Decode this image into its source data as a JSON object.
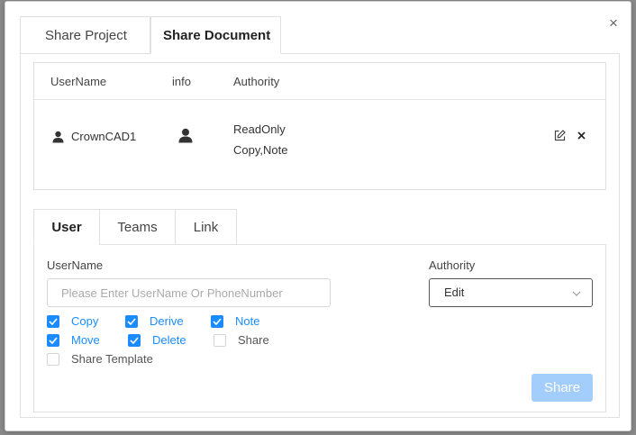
{
  "dialog": {
    "close_glyph": "×",
    "tabs": [
      {
        "label": "Share Project",
        "active": false
      },
      {
        "label": "Share Document",
        "active": true
      }
    ]
  },
  "share_table": {
    "columns": [
      "UserName",
      "info",
      "Authority"
    ],
    "rows": [
      {
        "username": "CrownCAD1",
        "user_icon": "user-icon",
        "info_icon": "user-icon",
        "authority_line1": "ReadOnly",
        "authority_line2": "Copy,Note",
        "actions": [
          "edit-icon",
          "close-icon"
        ]
      }
    ]
  },
  "sub_tabs": [
    {
      "label": "User",
      "active": true
    },
    {
      "label": "Teams",
      "active": false
    },
    {
      "label": "Link",
      "active": false
    }
  ],
  "form": {
    "username_label": "UserName",
    "username_value": "",
    "username_placeholder": "Please Enter UserName Or PhoneNumber",
    "authority_label": "Authority",
    "authority_value": "Edit",
    "permissions": [
      {
        "label": "Copy",
        "checked": true
      },
      {
        "label": "Derive",
        "checked": true
      },
      {
        "label": "Note",
        "checked": true
      },
      {
        "label": "Move",
        "checked": true
      },
      {
        "label": "Delete",
        "checked": true
      },
      {
        "label": "Share",
        "checked": false
      },
      {
        "label": "Share Template",
        "checked": false
      }
    ],
    "share_button": "Share"
  },
  "colors": {
    "accent": "#1a8cff",
    "share_button_disabled": "#a3cdfb",
    "border": "#e0e0e0"
  }
}
